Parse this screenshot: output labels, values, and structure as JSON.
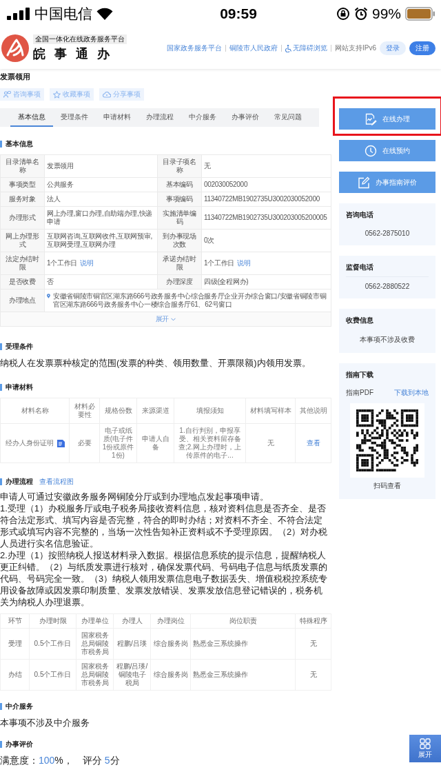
{
  "status_bar": {
    "carrier": "中国电信",
    "time": "09:59",
    "battery": "99%"
  },
  "header": {
    "platform": "全国一体化在线政务服务平台",
    "brand": "皖 事 通 办",
    "links": [
      {
        "label": "国家政务服务平台",
        "kind": "plain"
      },
      {
        "label": "铜陵市人民政府",
        "kind": "plain"
      },
      {
        "label": "无障碍浏览",
        "kind": "accessibility"
      }
    ],
    "ipv6": "网站支持IPv6",
    "login": "登录",
    "register": "注册"
  },
  "page_title": "发票领用",
  "actions": [
    {
      "label": "咨询事项",
      "kind": "consult"
    },
    {
      "label": "收藏事项",
      "kind": "favorite"
    },
    {
      "label": "分享事项",
      "kind": "share"
    }
  ],
  "tabs": [
    {
      "label": "基本信息",
      "selected": true
    },
    {
      "label": "受理条件",
      "selected": false
    },
    {
      "label": "申请材料",
      "selected": false
    },
    {
      "label": "办理流程",
      "selected": false
    },
    {
      "label": "中介服务",
      "selected": false
    },
    {
      "label": "办事评价",
      "selected": false
    },
    {
      "label": "常见问题",
      "selected": false
    }
  ],
  "basic_info": {
    "heading": "基本信息",
    "rows": [
      [
        {
          "label": "目录清单名称",
          "value": "发票领用"
        },
        {
          "label": "目录子项名称",
          "value": "无"
        }
      ],
      [
        {
          "label": "事项类型",
          "value": "公共服务"
        },
        {
          "label": "基本编码",
          "value": "002030052000"
        }
      ],
      [
        {
          "label": "服务对象",
          "value": "法人"
        },
        {
          "label": "事项编码",
          "value": "11340722MB1902735U3002030052000"
        }
      ],
      [
        {
          "label": "办理形式",
          "value": "网上办理,窗口办理,自助端办理,快递申请"
        },
        {
          "label": "实施清单编码",
          "value": "11340722MB1902735U300203005200005"
        }
      ],
      [
        {
          "label": "网上办理形式",
          "value": "互联网咨询,互联网收件,互联网预审,互联网受理,互联网办理"
        },
        {
          "label": "到办事现场次数",
          "value": "0次"
        }
      ],
      [
        {
          "label": "法定办结时限",
          "value": "1个工作日",
          "link": "说明"
        },
        {
          "label": "承诺办结时限",
          "value": "1个工作日",
          "link": "说明"
        }
      ],
      [
        {
          "label": "是否收费",
          "value": "否"
        },
        {
          "label": "办理深度",
          "value": "四级(全程网办)"
        }
      ]
    ],
    "address": {
      "label": "办理地点",
      "value": "安徽省铜陵市铜官区湖东路666号政务服务中心综合服务厅企业开办综合窗口/安徽省铜陵市铜官区湖东路666号政务服务中心一楼综合服务厅61、62号窗口"
    },
    "expand": "展开"
  },
  "conditions": {
    "heading": "受理条件",
    "text": "纳税人在发票票种核定的范围(发票的种类、领用数量、开票限额)内领用发票。"
  },
  "materials": {
    "heading": "申请材料",
    "columns": [
      "材料名称",
      "材料必要性",
      "规格份数",
      "来源渠道",
      "填报须知",
      "材料填写样本",
      "其他说明"
    ],
    "rows": [
      {
        "name": "经办人身份证明",
        "necessity": "必要",
        "spec": "电子或纸质(电子件1份或原件1份)",
        "source": "申请人自备",
        "notice": "1.自行判别，申报享受、相关资料留存备查;2.网上办理时，上传原件的电子...",
        "sample": "无",
        "other": "查看"
      }
    ]
  },
  "process": {
    "heading": "办理流程",
    "link": "查看流程图",
    "paragraphs": [
      "申请人可通过安徽政务服务网铜陵分厅或到办理地点发起事项申请。",
      "1.受理（1）办税服务厅或电子税务局接收资料信息，核对资料信息是否齐全、是否符合法定形式、填写内容是否完整，符合的即时办结；对资料不齐全、不符合法定形式或填写内容不完整的，当场一次性告知补正资料或不予受理原因。（2）对办税人员进行实名信息验证。",
      "2.办理（1）按照纳税人报送材料录入数据。根据信息系统的提示信息，提醒纳税人更正纠错。（2）与纸质发票进行核对，确保发票代码、号码电子信息与纸质发票的代码、号码完全一致。（3）纳税人领用发票信息电子数据丢失、增值税税控系统专用设备故障或因发票印制质量、发票发放错误、发票发放信息登记错误的，税务机关为纳税人办理退票。"
    ],
    "columns": [
      "环节",
      "办理时限",
      "办理单位",
      "办理人",
      "办理岗位",
      "岗位职责",
      "特殊程序"
    ],
    "rows": [
      [
        "受理",
        "0.5个工作日",
        "国家税务总局铜陵市税务局",
        "程鹏/吕瑛",
        "综合服务岗",
        "熟悉金三系统操作",
        "无"
      ],
      [
        "办结",
        "0.5个工作日",
        "国家税务总局铜陵市税务局",
        "程鹏/吕瑛/铜陵电子税局",
        "综合服务岗",
        "熟悉金三系统操作",
        "无"
      ]
    ]
  },
  "intermediary": {
    "heading": "中介服务",
    "text": "本事项不涉及中介服务"
  },
  "evaluation": {
    "heading": "办事评价",
    "satisfaction_label": "满意度：",
    "satisfaction": "100",
    "satisfaction_unit": "%，",
    "score_label": "评分",
    "score": "5",
    "score_unit": "分"
  },
  "sidebar": {
    "buttons": [
      {
        "label": "在线办理",
        "kind": "online",
        "highlighted": true
      },
      {
        "label": "在线预约",
        "kind": "appointment",
        "highlighted": false
      },
      {
        "label": "办事指南评价",
        "kind": "review",
        "highlighted": false
      }
    ],
    "cards": [
      {
        "kind": "phone",
        "title": "咨询电话",
        "text": "0562-2875010"
      },
      {
        "kind": "phone",
        "title": "监督电话",
        "text": "0562-2880522"
      },
      {
        "kind": "info",
        "title": "收费信息",
        "text": "本事项不涉及收费"
      },
      {
        "kind": "download",
        "title": "指南下载",
        "file_label": "指南PDF",
        "link": "下载到本地",
        "caption": "扫码查看"
      }
    ]
  },
  "float_button": {
    "label": "展开"
  }
}
